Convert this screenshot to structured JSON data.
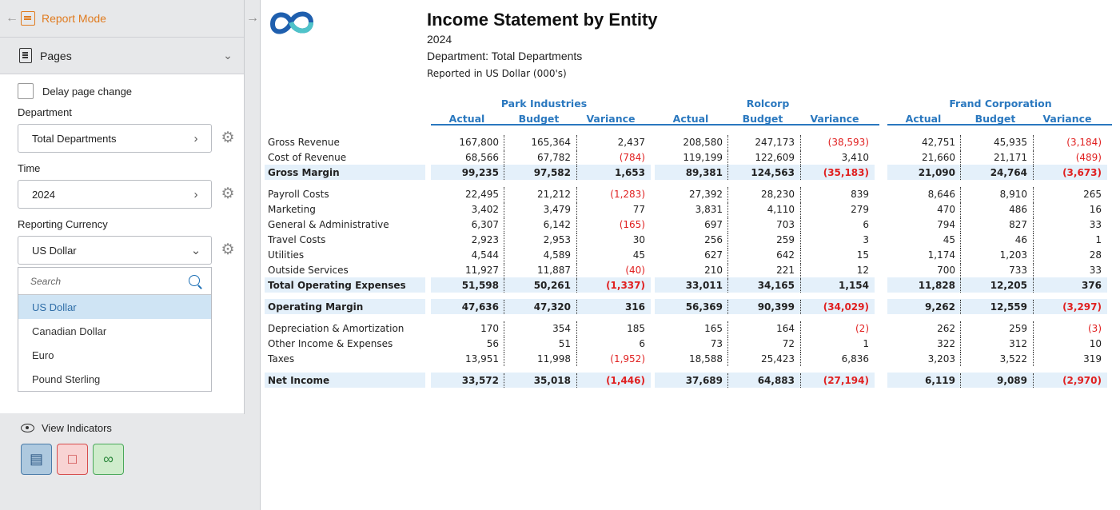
{
  "sidebar": {
    "mode_title": "Report Mode",
    "pages_label": "Pages",
    "delay_label": "Delay page change",
    "department": {
      "label": "Department",
      "value": "Total Departments"
    },
    "time": {
      "label": "Time",
      "value": "2024"
    },
    "currency": {
      "label": "Reporting Currency",
      "value": "US Dollar",
      "search_placeholder": "Search",
      "options": [
        "US Dollar",
        "Canadian Dollar",
        "Euro",
        "Pound Sterling"
      ],
      "selected_index": 0
    },
    "indicators_label": "View Indicators",
    "indicator_colors": {
      "blue": "#aec9df",
      "red": "#f8d3d3",
      "green": "#cfeccc"
    }
  },
  "report": {
    "title": "Income Statement by Entity",
    "year": "2024",
    "department_line": "Department: Total Departments",
    "note": "Reported in US Dollar (000's)",
    "entities": [
      "Park Industries",
      "Rolcorp",
      "Frand Corporation"
    ],
    "columns": [
      "Actual",
      "Budget",
      "Variance"
    ],
    "rows": [
      {
        "label": "Gross Revenue",
        "total": false,
        "values": [
          "167,800",
          "165,364",
          "2,437",
          "208,580",
          "247,173",
          "(38,593)",
          "42,751",
          "45,935",
          "(3,184)"
        ]
      },
      {
        "label": "Cost of Revenue",
        "total": false,
        "values": [
          "68,566",
          "67,782",
          "(784)",
          "119,199",
          "122,609",
          "3,410",
          "21,660",
          "21,171",
          "(489)"
        ]
      },
      {
        "label": "Gross Margin",
        "total": true,
        "values": [
          "99,235",
          "97,582",
          "1,653",
          "89,381",
          "124,563",
          "(35,183)",
          "21,090",
          "24,764",
          "(3,673)"
        ]
      },
      {
        "label": "Payroll Costs",
        "total": false,
        "values": [
          "22,495",
          "21,212",
          "(1,283)",
          "27,392",
          "28,230",
          "839",
          "8,646",
          "8,910",
          "265"
        ]
      },
      {
        "label": "Marketing",
        "total": false,
        "values": [
          "3,402",
          "3,479",
          "77",
          "3,831",
          "4,110",
          "279",
          "470",
          "486",
          "16"
        ]
      },
      {
        "label": "General & Administrative",
        "total": false,
        "values": [
          "6,307",
          "6,142",
          "(165)",
          "697",
          "703",
          "6",
          "794",
          "827",
          "33"
        ]
      },
      {
        "label": "Travel Costs",
        "total": false,
        "values": [
          "2,923",
          "2,953",
          "30",
          "256",
          "259",
          "3",
          "45",
          "46",
          "1"
        ]
      },
      {
        "label": "Utilities",
        "total": false,
        "values": [
          "4,544",
          "4,589",
          "45",
          "627",
          "642",
          "15",
          "1,174",
          "1,203",
          "28"
        ]
      },
      {
        "label": "Outside Services",
        "total": false,
        "values": [
          "11,927",
          "11,887",
          "(40)",
          "210",
          "221",
          "12",
          "700",
          "733",
          "33"
        ]
      },
      {
        "label": "Total Operating Expenses",
        "total": true,
        "values": [
          "51,598",
          "50,261",
          "(1,337)",
          "33,011",
          "34,165",
          "1,154",
          "11,828",
          "12,205",
          "376"
        ]
      },
      {
        "label": "Operating Margin",
        "total": true,
        "values": [
          "47,636",
          "47,320",
          "316",
          "56,369",
          "90,399",
          "(34,029)",
          "9,262",
          "12,559",
          "(3,297)"
        ]
      },
      {
        "label": "Depreciation & Amortization",
        "total": false,
        "values": [
          "170",
          "354",
          "185",
          "165",
          "164",
          "(2)",
          "262",
          "259",
          "(3)"
        ]
      },
      {
        "label": "Other Income & Expenses",
        "total": false,
        "values": [
          "56",
          "51",
          "6",
          "73",
          "72",
          "1",
          "322",
          "312",
          "10"
        ]
      },
      {
        "label": "Taxes",
        "total": false,
        "values": [
          "13,951",
          "11,998",
          "(1,952)",
          "18,588",
          "25,423",
          "6,836",
          "3,203",
          "3,522",
          "319"
        ]
      },
      {
        "label": "Net Income",
        "total": true,
        "values": [
          "33,572",
          "35,018",
          "(1,446)",
          "37,689",
          "64,883",
          "(27,194)",
          "6,119",
          "9,089",
          "(2,970)"
        ]
      }
    ]
  }
}
